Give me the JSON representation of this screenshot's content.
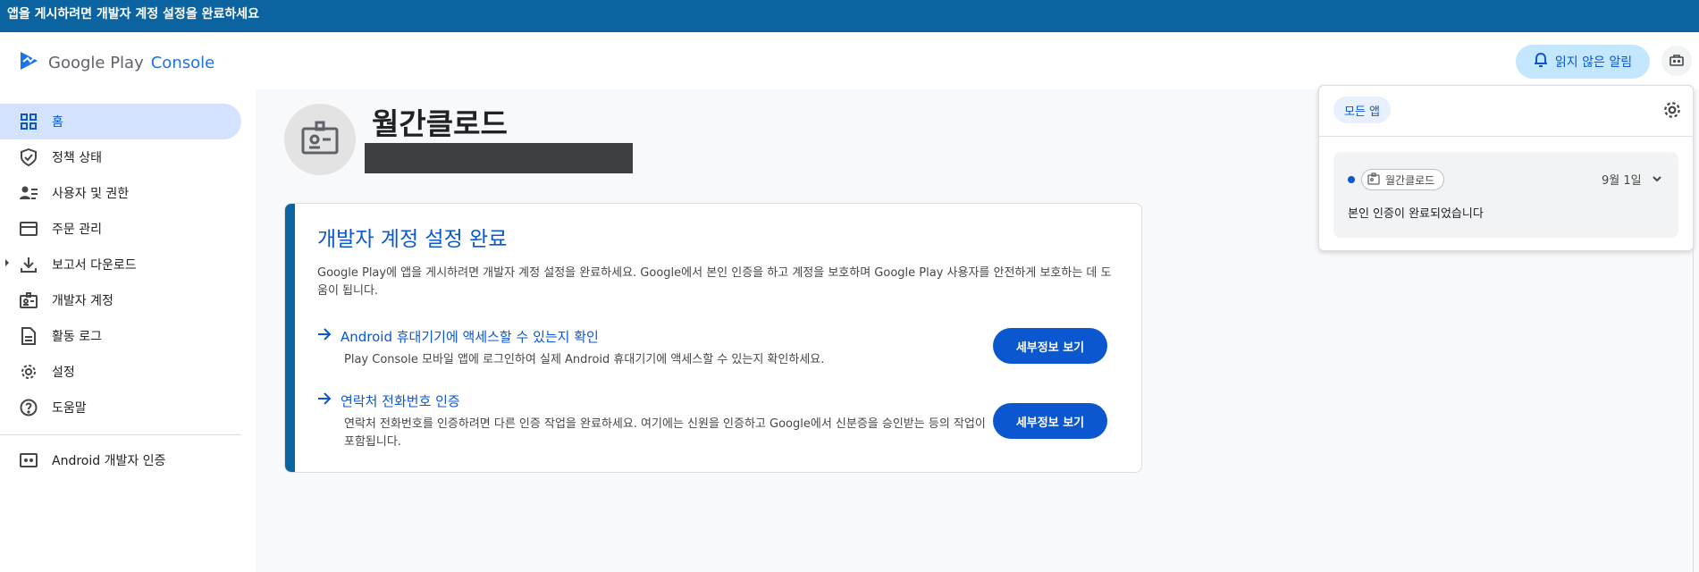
{
  "banner": {
    "text": "앱을 게시하려면 개발자 계정 설정을 완료하세요"
  },
  "logo": {
    "part1": "Google Play",
    "part2": "Console"
  },
  "sidebar": {
    "items": [
      {
        "label": "홈",
        "icon": "dashboard-icon",
        "active": true
      },
      {
        "label": "정책 상태",
        "icon": "shield-check-icon"
      },
      {
        "label": "사용자 및 권한",
        "icon": "users-icon"
      },
      {
        "label": "주문 관리",
        "icon": "credit-card-icon"
      },
      {
        "label": "보고서 다운로드",
        "icon": "download-icon"
      },
      {
        "label": "개발자 계정",
        "icon": "badge-icon"
      },
      {
        "label": "활동 로그",
        "icon": "document-icon"
      },
      {
        "label": "설정",
        "icon": "gear-icon"
      },
      {
        "label": "도움말",
        "icon": "help-icon"
      }
    ],
    "footer_item": {
      "label": "Android 개발자 인증",
      "icon": "android-icon"
    }
  },
  "header": {
    "alerts_label": "읽지 않은 알림"
  },
  "app": {
    "name": "월간클로드"
  },
  "card": {
    "title": "개발자 계정 설정 완료",
    "description": "Google Play에 앱을 게시하려면 개발자 계정 설정을 완료하세요. Google에서 본인 인증을 하고 계정을 보호하며 Google Play 사용자를 안전하게 보호하는 데 도움이 됩니다.",
    "tasks": [
      {
        "title": "Android 휴대기기에 액세스할 수 있는지 확인",
        "description": "Play Console 모바일 앱에 로그인하여 실제 Android 휴대기기에 액세스할 수 있는지 확인하세요.",
        "button": "세부정보 보기"
      },
      {
        "title": "연락처 전화번호 인증",
        "description": "연락처 전화번호를 인증하려면 다른 인증 작업을 완료하세요. 여기에는 신원을 인증하고 Google에서 신분증을 승인받는 등의 작업이 포함됩니다.",
        "button": "세부정보 보기"
      }
    ]
  },
  "notifications": {
    "filter_chip": "모든 앱",
    "items": [
      {
        "app": "월간클로드",
        "date": "9월 1일",
        "message": "본인 인증이 완료되었습니다",
        "unread": true
      }
    ]
  },
  "colors": {
    "banner": "#0b64a0",
    "accent": "#0b57d0",
    "active_nav": "#d3e3fd",
    "alert_button": "#c2e7ff"
  }
}
